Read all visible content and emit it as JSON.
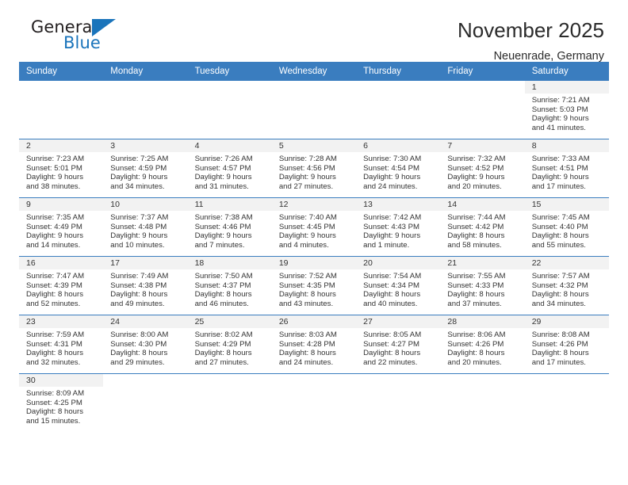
{
  "brand": {
    "name_part1": "General",
    "name_part2": "Blue",
    "flag_icon": "triangle-flag-icon"
  },
  "header": {
    "month_title": "November 2025",
    "location": "Neuenrade, Germany"
  },
  "calendar": {
    "weekday_headers": [
      "Sunday",
      "Monday",
      "Tuesday",
      "Wednesday",
      "Thursday",
      "Friday",
      "Saturday"
    ],
    "accent_color": "#3a7dbf",
    "daynum_bg": "#f2f2f2",
    "weeks": [
      [
        {
          "day": "",
          "sunrise": "",
          "sunset": "",
          "daylight1": "",
          "daylight2": ""
        },
        {
          "day": "",
          "sunrise": "",
          "sunset": "",
          "daylight1": "",
          "daylight2": ""
        },
        {
          "day": "",
          "sunrise": "",
          "sunset": "",
          "daylight1": "",
          "daylight2": ""
        },
        {
          "day": "",
          "sunrise": "",
          "sunset": "",
          "daylight1": "",
          "daylight2": ""
        },
        {
          "day": "",
          "sunrise": "",
          "sunset": "",
          "daylight1": "",
          "daylight2": ""
        },
        {
          "day": "",
          "sunrise": "",
          "sunset": "",
          "daylight1": "",
          "daylight2": ""
        },
        {
          "day": "1",
          "sunrise": "Sunrise: 7:21 AM",
          "sunset": "Sunset: 5:03 PM",
          "daylight1": "Daylight: 9 hours",
          "daylight2": "and 41 minutes."
        }
      ],
      [
        {
          "day": "2",
          "sunrise": "Sunrise: 7:23 AM",
          "sunset": "Sunset: 5:01 PM",
          "daylight1": "Daylight: 9 hours",
          "daylight2": "and 38 minutes."
        },
        {
          "day": "3",
          "sunrise": "Sunrise: 7:25 AM",
          "sunset": "Sunset: 4:59 PM",
          "daylight1": "Daylight: 9 hours",
          "daylight2": "and 34 minutes."
        },
        {
          "day": "4",
          "sunrise": "Sunrise: 7:26 AM",
          "sunset": "Sunset: 4:57 PM",
          "daylight1": "Daylight: 9 hours",
          "daylight2": "and 31 minutes."
        },
        {
          "day": "5",
          "sunrise": "Sunrise: 7:28 AM",
          "sunset": "Sunset: 4:56 PM",
          "daylight1": "Daylight: 9 hours",
          "daylight2": "and 27 minutes."
        },
        {
          "day": "6",
          "sunrise": "Sunrise: 7:30 AM",
          "sunset": "Sunset: 4:54 PM",
          "daylight1": "Daylight: 9 hours",
          "daylight2": "and 24 minutes."
        },
        {
          "day": "7",
          "sunrise": "Sunrise: 7:32 AM",
          "sunset": "Sunset: 4:52 PM",
          "daylight1": "Daylight: 9 hours",
          "daylight2": "and 20 minutes."
        },
        {
          "day": "8",
          "sunrise": "Sunrise: 7:33 AM",
          "sunset": "Sunset: 4:51 PM",
          "daylight1": "Daylight: 9 hours",
          "daylight2": "and 17 minutes."
        }
      ],
      [
        {
          "day": "9",
          "sunrise": "Sunrise: 7:35 AM",
          "sunset": "Sunset: 4:49 PM",
          "daylight1": "Daylight: 9 hours",
          "daylight2": "and 14 minutes."
        },
        {
          "day": "10",
          "sunrise": "Sunrise: 7:37 AM",
          "sunset": "Sunset: 4:48 PM",
          "daylight1": "Daylight: 9 hours",
          "daylight2": "and 10 minutes."
        },
        {
          "day": "11",
          "sunrise": "Sunrise: 7:38 AM",
          "sunset": "Sunset: 4:46 PM",
          "daylight1": "Daylight: 9 hours",
          "daylight2": "and 7 minutes."
        },
        {
          "day": "12",
          "sunrise": "Sunrise: 7:40 AM",
          "sunset": "Sunset: 4:45 PM",
          "daylight1": "Daylight: 9 hours",
          "daylight2": "and 4 minutes."
        },
        {
          "day": "13",
          "sunrise": "Sunrise: 7:42 AM",
          "sunset": "Sunset: 4:43 PM",
          "daylight1": "Daylight: 9 hours",
          "daylight2": "and 1 minute."
        },
        {
          "day": "14",
          "sunrise": "Sunrise: 7:44 AM",
          "sunset": "Sunset: 4:42 PM",
          "daylight1": "Daylight: 8 hours",
          "daylight2": "and 58 minutes."
        },
        {
          "day": "15",
          "sunrise": "Sunrise: 7:45 AM",
          "sunset": "Sunset: 4:40 PM",
          "daylight1": "Daylight: 8 hours",
          "daylight2": "and 55 minutes."
        }
      ],
      [
        {
          "day": "16",
          "sunrise": "Sunrise: 7:47 AM",
          "sunset": "Sunset: 4:39 PM",
          "daylight1": "Daylight: 8 hours",
          "daylight2": "and 52 minutes."
        },
        {
          "day": "17",
          "sunrise": "Sunrise: 7:49 AM",
          "sunset": "Sunset: 4:38 PM",
          "daylight1": "Daylight: 8 hours",
          "daylight2": "and 49 minutes."
        },
        {
          "day": "18",
          "sunrise": "Sunrise: 7:50 AM",
          "sunset": "Sunset: 4:37 PM",
          "daylight1": "Daylight: 8 hours",
          "daylight2": "and 46 minutes."
        },
        {
          "day": "19",
          "sunrise": "Sunrise: 7:52 AM",
          "sunset": "Sunset: 4:35 PM",
          "daylight1": "Daylight: 8 hours",
          "daylight2": "and 43 minutes."
        },
        {
          "day": "20",
          "sunrise": "Sunrise: 7:54 AM",
          "sunset": "Sunset: 4:34 PM",
          "daylight1": "Daylight: 8 hours",
          "daylight2": "and 40 minutes."
        },
        {
          "day": "21",
          "sunrise": "Sunrise: 7:55 AM",
          "sunset": "Sunset: 4:33 PM",
          "daylight1": "Daylight: 8 hours",
          "daylight2": "and 37 minutes."
        },
        {
          "day": "22",
          "sunrise": "Sunrise: 7:57 AM",
          "sunset": "Sunset: 4:32 PM",
          "daylight1": "Daylight: 8 hours",
          "daylight2": "and 34 minutes."
        }
      ],
      [
        {
          "day": "23",
          "sunrise": "Sunrise: 7:59 AM",
          "sunset": "Sunset: 4:31 PM",
          "daylight1": "Daylight: 8 hours",
          "daylight2": "and 32 minutes."
        },
        {
          "day": "24",
          "sunrise": "Sunrise: 8:00 AM",
          "sunset": "Sunset: 4:30 PM",
          "daylight1": "Daylight: 8 hours",
          "daylight2": "and 29 minutes."
        },
        {
          "day": "25",
          "sunrise": "Sunrise: 8:02 AM",
          "sunset": "Sunset: 4:29 PM",
          "daylight1": "Daylight: 8 hours",
          "daylight2": "and 27 minutes."
        },
        {
          "day": "26",
          "sunrise": "Sunrise: 8:03 AM",
          "sunset": "Sunset: 4:28 PM",
          "daylight1": "Daylight: 8 hours",
          "daylight2": "and 24 minutes."
        },
        {
          "day": "27",
          "sunrise": "Sunrise: 8:05 AM",
          "sunset": "Sunset: 4:27 PM",
          "daylight1": "Daylight: 8 hours",
          "daylight2": "and 22 minutes."
        },
        {
          "day": "28",
          "sunrise": "Sunrise: 8:06 AM",
          "sunset": "Sunset: 4:26 PM",
          "daylight1": "Daylight: 8 hours",
          "daylight2": "and 20 minutes."
        },
        {
          "day": "29",
          "sunrise": "Sunrise: 8:08 AM",
          "sunset": "Sunset: 4:26 PM",
          "daylight1": "Daylight: 8 hours",
          "daylight2": "and 17 minutes."
        }
      ],
      [
        {
          "day": "30",
          "sunrise": "Sunrise: 8:09 AM",
          "sunset": "Sunset: 4:25 PM",
          "daylight1": "Daylight: 8 hours",
          "daylight2": "and 15 minutes."
        },
        {
          "day": "",
          "sunrise": "",
          "sunset": "",
          "daylight1": "",
          "daylight2": ""
        },
        {
          "day": "",
          "sunrise": "",
          "sunset": "",
          "daylight1": "",
          "daylight2": ""
        },
        {
          "day": "",
          "sunrise": "",
          "sunset": "",
          "daylight1": "",
          "daylight2": ""
        },
        {
          "day": "",
          "sunrise": "",
          "sunset": "",
          "daylight1": "",
          "daylight2": ""
        },
        {
          "day": "",
          "sunrise": "",
          "sunset": "",
          "daylight1": "",
          "daylight2": ""
        },
        {
          "day": "",
          "sunrise": "",
          "sunset": "",
          "daylight1": "",
          "daylight2": ""
        }
      ]
    ]
  }
}
